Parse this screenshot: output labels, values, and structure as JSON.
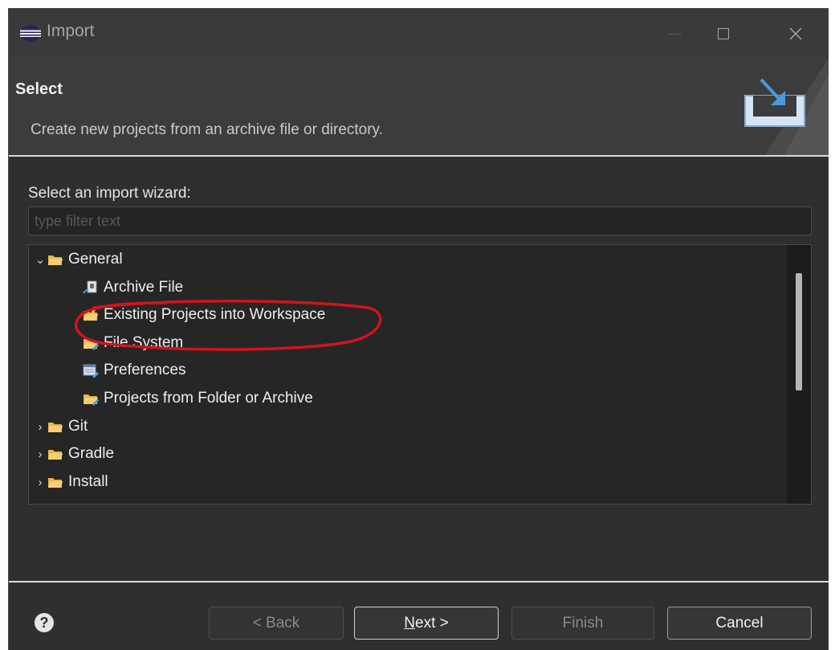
{
  "window": {
    "title": "Import",
    "app_icon": "eclipse-icon"
  },
  "header": {
    "title": "Select",
    "description": "Create new projects from an archive file or directory.",
    "banner_icon": "import-wizard-icon"
  },
  "main": {
    "wizard_label": "Select an import wizard:",
    "filter_placeholder": "type filter text",
    "filter_value": "",
    "tree": [
      {
        "label": "General",
        "expanded": true,
        "icon": "folder-icon",
        "level": 0
      },
      {
        "label": "Archive File",
        "icon": "archive-file-icon",
        "level": 1
      },
      {
        "label": "Existing Projects into Workspace",
        "icon": "project-folder-icon",
        "level": 1,
        "circled": true
      },
      {
        "label": "File System",
        "icon": "file-system-icon",
        "level": 1
      },
      {
        "label": "Preferences",
        "icon": "preferences-icon",
        "level": 1
      },
      {
        "label": "Projects from Folder or Archive",
        "icon": "project-folder-icon",
        "level": 1
      },
      {
        "label": "Git",
        "expanded": false,
        "icon": "folder-icon",
        "level": 0
      },
      {
        "label": "Gradle",
        "expanded": false,
        "icon": "folder-icon",
        "level": 0
      },
      {
        "label": "Install",
        "expanded": false,
        "icon": "folder-icon",
        "level": 0
      }
    ]
  },
  "footer": {
    "help_icon": "help-icon",
    "back_label": "< Back",
    "next_mnemonic": "N",
    "next_rest": "ext >",
    "finish_label": "Finish",
    "cancel_label": "Cancel"
  },
  "colors": {
    "background": "#2f2f2f",
    "header_background": "#3c3c3c",
    "annotation_red": "#d0141b"
  }
}
